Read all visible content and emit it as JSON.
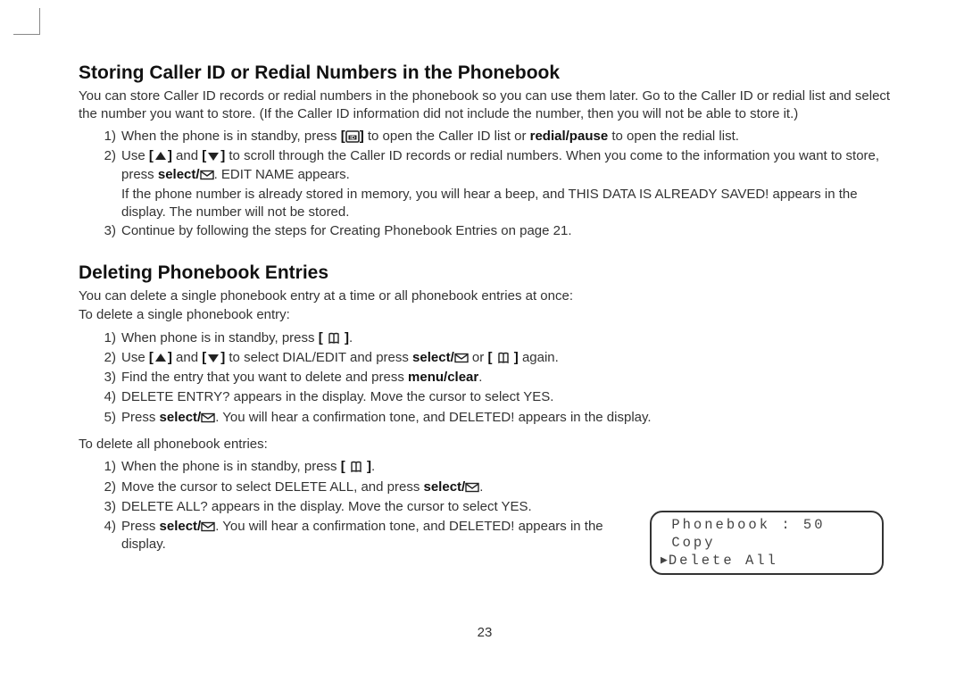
{
  "section1": {
    "title": "Storing Caller ID or Redial Numbers in the Phonebook",
    "intro": "You can store Caller ID records or redial numbers in the phonebook so you can use them later. Go to the Caller ID or redial list and select the number you want to store. (If the Caller ID information did not include the number, then you will not be able to store it.)",
    "step1_a": "When the phone is in standby, press ",
    "step1_b": " to open the Caller ID list or ",
    "step1_c": "redial/pause",
    "step1_d": " to open the redial list.",
    "step2_a": "Use ",
    "step2_b": " and ",
    "step2_c": " to scroll through the Caller ID records or redial numbers. When you come to the information you want to store, press ",
    "step2_d": "select/",
    "step2_e": ". EDIT NAME appears.",
    "step2_note": "If the phone number is already stored in memory, you will hear a beep, and THIS DATA IS ALREADY SAVED! appears in the display. The number will not be stored.",
    "step3": "Continue by following the steps for Creating Phonebook Entries on page 21."
  },
  "section2": {
    "title": "Deleting Phonebook Entries",
    "intro": "You can delete a single phonebook entry at a time or all phonebook entries at once:",
    "sub1": "To delete a single phonebook entry:",
    "s1_1a": "When phone is in standby, press ",
    "s1_1b": ".",
    "s1_2a": "Use ",
    "s1_2b": " and ",
    "s1_2c": " to select DIAL/EDIT and press ",
    "s1_2d": "select/",
    "s1_2e": " or ",
    "s1_2f": " again.",
    "s1_3a": "Find the entry that you want to delete and press ",
    "s1_3b": "menu/clear",
    "s1_3c": ".",
    "s1_4": "DELETE ENTRY? appears in the display. Move the cursor to select YES.",
    "s1_5a": "Press ",
    "s1_5b": "select/",
    "s1_5c": ". You will hear a confirmation tone, and DELETED! appears in the display.",
    "sub2": "To delete all phonebook entries:",
    "s2_1a": "When the phone is in standby, press ",
    "s2_1b": ".",
    "s2_2a": "Move the cursor to select DELETE ALL, and press ",
    "s2_2b": "select/",
    "s2_2c": ".",
    "s2_3": "DELETE ALL? appears in the display. Move the cursor to select YES.",
    "s2_4a": "Press ",
    "s2_4b": "select/",
    "s2_4c": ". You will hear a confirmation tone, and DELETED! appears in the display."
  },
  "lcd": {
    "line1": "Phonebook : 50",
    "line2": "Copy",
    "line3": "Delete All"
  },
  "pagenum": "23",
  "nums": {
    "n1": "1)",
    "n2": "2)",
    "n3": "3)",
    "n4": "4)",
    "n5": "5)"
  },
  "brackets": {
    "open": "[ ",
    "close": " ]",
    "openb": "[",
    "closeb": "]"
  }
}
